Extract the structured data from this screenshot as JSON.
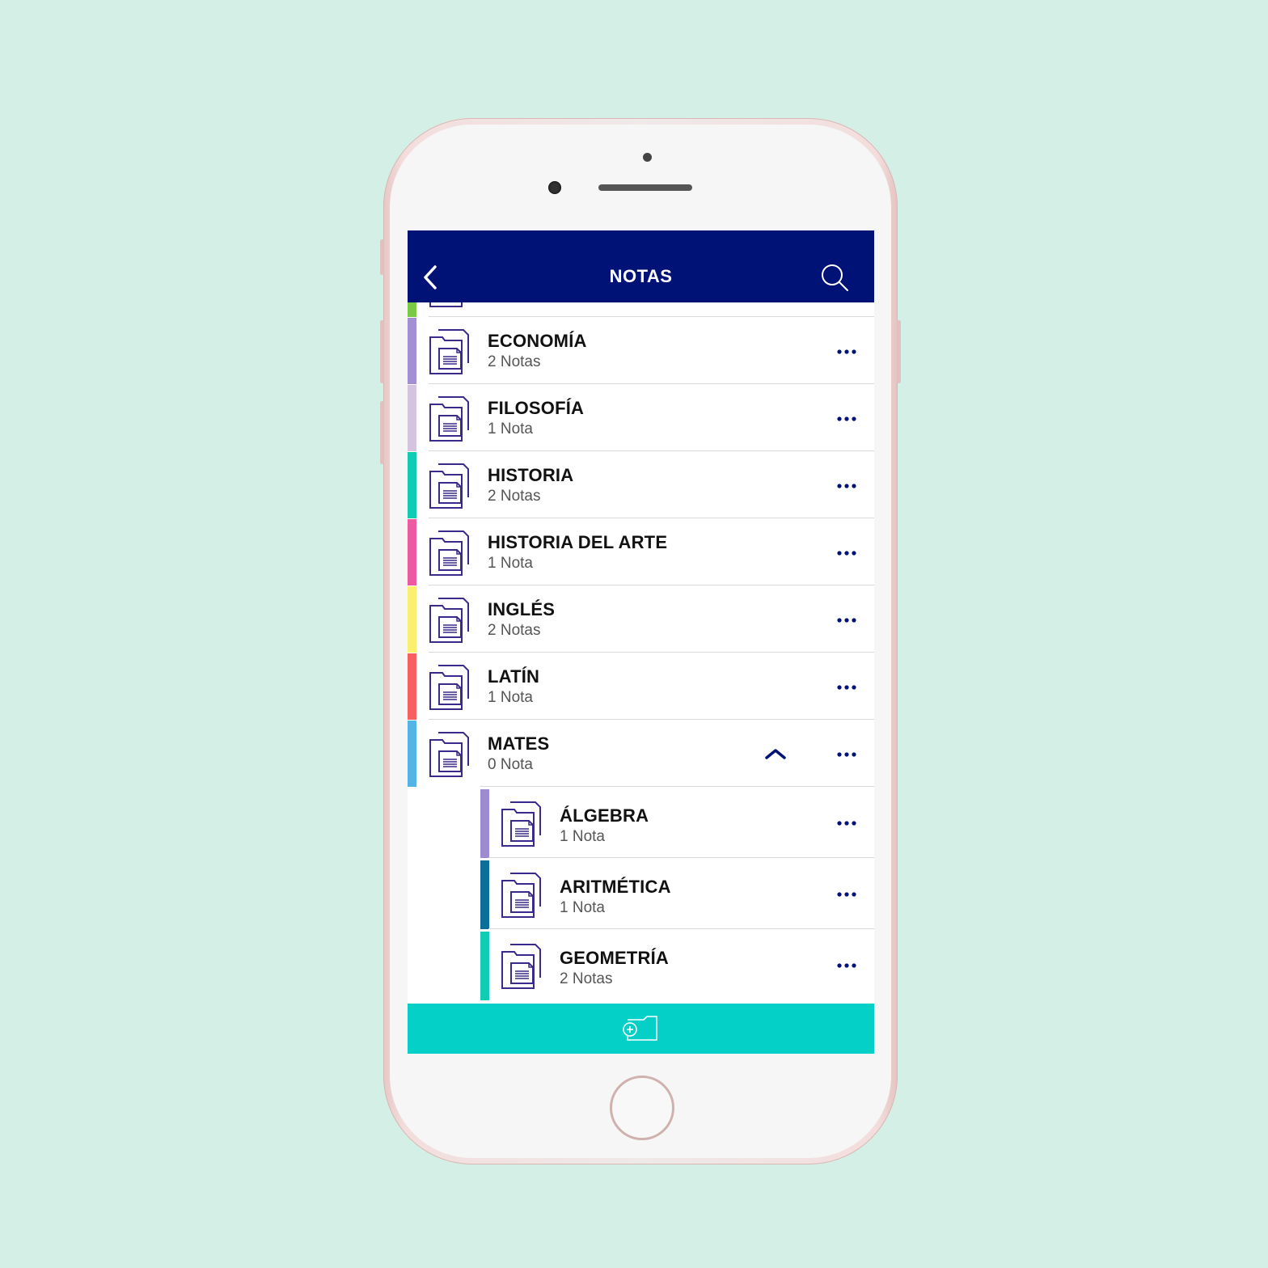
{
  "header": {
    "title": "NOTAS"
  },
  "colors": {
    "header_bg": "#001275",
    "accent": "#05d0c8",
    "icon": "#3a2a8c"
  },
  "categories": [
    {
      "name": "ECONOMÍA",
      "count": "2 Notas",
      "color": "#a390d4"
    },
    {
      "name": "FILOSOFÍA",
      "count": "1 Nota",
      "color": "#d4c4dd"
    },
    {
      "name": "HISTORIA",
      "count": "2 Notas",
      "color": "#10ccb4"
    },
    {
      "name": "HISTORIA DEL ARTE",
      "count": "1 Nota",
      "color": "#ec5aa2"
    },
    {
      "name": "INGLÉS",
      "count": "2 Notas",
      "color": "#fbef70"
    },
    {
      "name": "LATÍN",
      "count": "1 Nota",
      "color": "#f76060"
    },
    {
      "name": "MATES",
      "count": "0 Nota",
      "color": "#55b4e6",
      "expanded": true
    }
  ],
  "subcategories": [
    {
      "name": "ÁLGEBRA",
      "count": "1 Nota",
      "color": "#9d8ad0"
    },
    {
      "name": "ARITMÉTICA",
      "count": "1 Nota",
      "color": "#0c6e99"
    },
    {
      "name": "GEOMETRÍA",
      "count": "2 Notas",
      "color": "#10ccb4"
    }
  ],
  "icons": {
    "back": "chevron-left-icon",
    "search": "search-icon",
    "folder": "folder-notes-icon",
    "more": "more-horizontal-icon",
    "collapse": "chevron-up-icon",
    "add_folder": "add-folder-icon"
  }
}
